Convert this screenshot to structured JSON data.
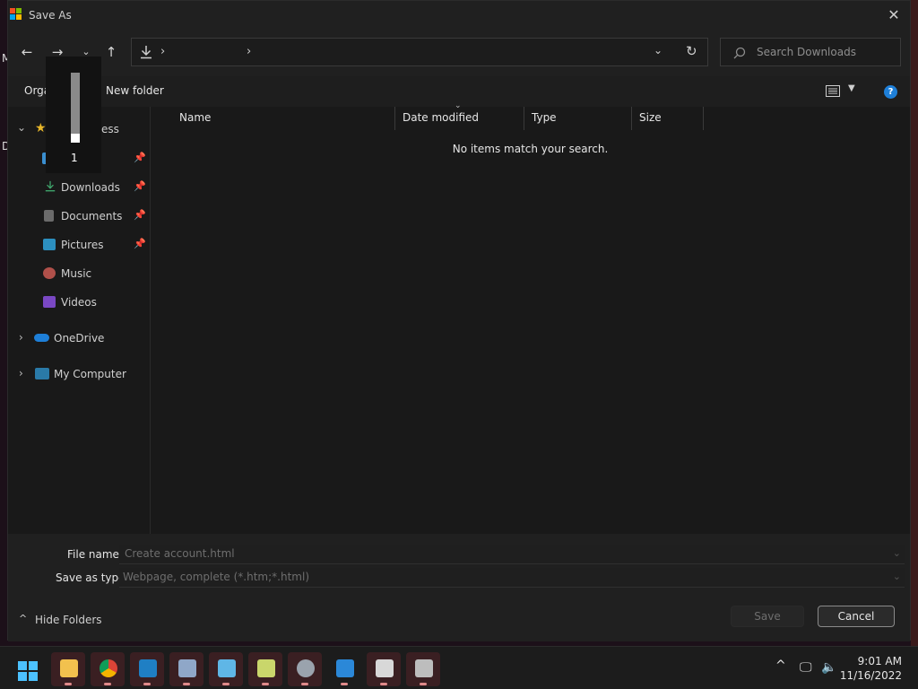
{
  "dialog": {
    "title": "Save As",
    "close_icon": "close-icon"
  },
  "desktop": {
    "letters": [
      "M",
      "D"
    ]
  },
  "nav": {
    "back_icon": "arrow-left-icon",
    "forward_icon": "arrow-right-icon",
    "recent_icon": "chevron-down-icon",
    "up_icon": "arrow-up-icon",
    "address_icon": "download-icon",
    "address_sep_1": "›",
    "address_sep_2": "›",
    "refresh_icon": "refresh-icon",
    "search_placeholder": "Search Downloads"
  },
  "toolbar": {
    "organize_label": "Orga",
    "new_folder_label": "New folder",
    "view_icon": "view-list-icon",
    "help_label": "?"
  },
  "sidebar": {
    "quick_access_partial": "ess",
    "items": [
      {
        "label": "Downloads",
        "icon": "download-icon",
        "pinned": true
      },
      {
        "label": "Documents",
        "icon": "document-icon",
        "pinned": true
      },
      {
        "label": "Pictures",
        "icon": "picture-icon",
        "pinned": true
      },
      {
        "label": "Music",
        "icon": "music-icon",
        "pinned": false
      },
      {
        "label": "Videos",
        "icon": "video-icon",
        "pinned": false
      }
    ],
    "onedrive_label": "OneDrive",
    "computer_label": "My Computer"
  },
  "scroll_overlay": {
    "value": "1"
  },
  "filelist": {
    "columns": [
      "Name",
      "Date modified",
      "Type",
      "Size"
    ],
    "empty_message": "No items match your search."
  },
  "bottom": {
    "file_name_label": "File name:",
    "file_name_value": "Create account.html",
    "save_type_label": "Save as type:",
    "save_type_value": "Webpage, complete (*.htm;*.html)",
    "hide_folders_label": "Hide Folders",
    "save_label": "Save",
    "cancel_label": "Cancel"
  },
  "taskbar": {
    "apps": [
      "start-icon",
      "file-explorer-icon",
      "chrome-icon",
      "photos-icon",
      "network-icon",
      "notepad-icon",
      "image-editor-icon",
      "settings-icon",
      "mail-icon",
      "viewer-icon",
      "tools-icon"
    ],
    "tray_chevron": "^",
    "time": "9:01 AM",
    "date": "11/16/2022"
  }
}
